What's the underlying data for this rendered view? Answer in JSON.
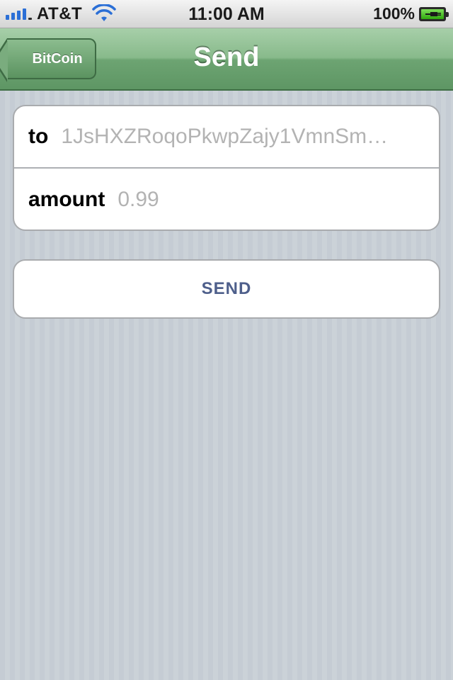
{
  "status_bar": {
    "carrier": "AT&T",
    "time": "11:00 AM",
    "battery_percent": "100%",
    "signal_icon": "signal-bars-icon",
    "wifi_icon": "wifi-icon",
    "battery_icon": "battery-charging-icon",
    "signal_color": "#2b6fd6",
    "battery_color": "#2fa80e"
  },
  "nav_bar": {
    "back_label": "BitCoin",
    "title": "Send",
    "tint_color": "#6da472"
  },
  "form": {
    "to_label": "to",
    "to_value": "1JsHXZRoqoPkwpZajy1VmnSm…",
    "amount_label": "amount",
    "amount_value": "0.99"
  },
  "send_button": {
    "label": "SEND",
    "text_color": "#4e5f8b"
  }
}
